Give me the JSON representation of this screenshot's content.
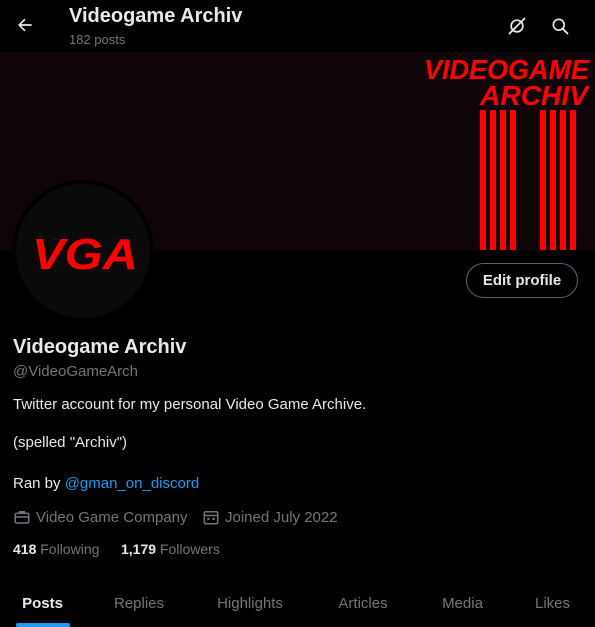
{
  "header": {
    "title": "Videogame Archiv",
    "post_count": "182 posts",
    "back_icon": "arrow-left-icon",
    "action_icons": [
      "grok-icon",
      "search-icon"
    ]
  },
  "banner": {
    "logo_line1": "VIDEOGAME",
    "logo_line2": "ARCHIV",
    "accent_color": "#ff0000"
  },
  "avatar": {
    "logo_text": "VGA",
    "color": "#ff0000"
  },
  "edit_profile_label": "Edit profile",
  "profile": {
    "name": "Videogame Archiv",
    "handle": "@VideoGameArch",
    "bio": {
      "line1": "Twitter account for my personal Video Game Archive.",
      "line2": "(spelled \"Archiv\")",
      "line3_prefix": "Ran by ",
      "line3_mention": "@gman_on_discord"
    },
    "category": "Video Game Company",
    "joined": "Joined July 2022"
  },
  "stats": {
    "following_count": "418",
    "following_label": "Following",
    "followers_count": "1,179",
    "followers_label": "Followers"
  },
  "tabs": [
    {
      "label": "Posts",
      "active": true
    },
    {
      "label": "Replies"
    },
    {
      "label": "Highlights"
    },
    {
      "label": "Articles"
    },
    {
      "label": "Media"
    },
    {
      "label": "Likes"
    }
  ],
  "colors": {
    "background": "#000000",
    "text": "#e7e9ea",
    "muted": "#71767b",
    "accent": "#1d9bf0"
  }
}
